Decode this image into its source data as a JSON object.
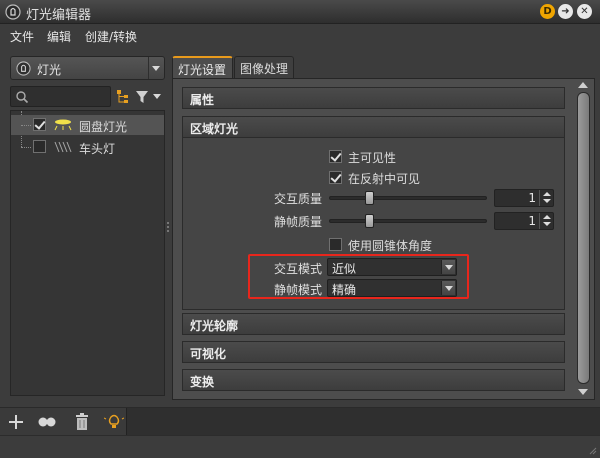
{
  "window": {
    "title": "灯光编辑器",
    "buttons": {
      "help": "D",
      "next": "➜",
      "close": "✕"
    }
  },
  "menu": {
    "items": [
      "文件",
      "编辑",
      "创建/转换"
    ]
  },
  "left_panel": {
    "light_selector": {
      "value": "灯光"
    },
    "search": {
      "placeholder": ""
    },
    "tree": [
      {
        "label": "圆盘灯光",
        "checked": true,
        "selected": true,
        "icon": "disc-light-icon"
      },
      {
        "label": "车头灯",
        "checked": false,
        "selected": false,
        "icon": "headlight-icon"
      }
    ]
  },
  "tabs": [
    {
      "label": "灯光设置",
      "active": true
    },
    {
      "label": "图像处理",
      "active": false
    }
  ],
  "sections": {
    "attributes": "属性",
    "area_light": "区域灯光",
    "light_profile": "灯光轮廓",
    "visualization": "可视化",
    "transform": "变换"
  },
  "area_light": {
    "main_visibility": {
      "label": "主可见性",
      "checked": true
    },
    "visible_in_reflection": {
      "label": "在反射中可见",
      "checked": true
    },
    "interactive_quality": {
      "label": "交互质量",
      "value": "1",
      "slider": 0.25
    },
    "still_quality": {
      "label": "静帧质量",
      "value": "1",
      "slider": 0.25
    },
    "use_cone_angle": {
      "label": "使用圆锥体角度",
      "checked": false
    },
    "interactive_mode": {
      "label": "交互模式",
      "value": "近似"
    },
    "still_mode": {
      "label": "静帧模式",
      "value": "精确"
    }
  },
  "colors": {
    "accent_tab": "#e89a1c",
    "highlight": "#e8261c",
    "help_button": "#f0a500"
  }
}
